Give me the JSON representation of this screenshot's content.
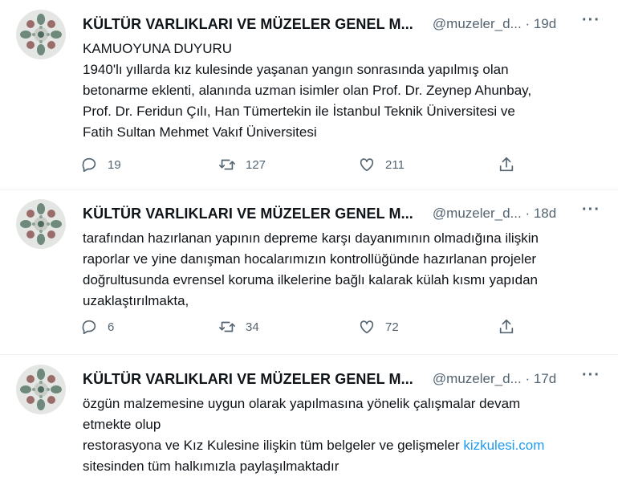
{
  "tweets": [
    {
      "name": "KÜLTÜR VARLIKLARI VE MÜZELER GENEL M...",
      "handle": "@muzeler_d...",
      "time": "· 19d",
      "more": "···",
      "lines": [
        "KAMUOYUNA DUYURU",
        "1940'lı yıllarda kız kulesinde yaşanan yangın sonrasında yapılmış olan",
        "betonarme eklenti, alanında uzman isimler olan Prof. Dr. Zeynep Ahunbay,",
        "Prof. Dr. Feridun Çılı, Han Tümertekin ile İstanbul Teknik Üniversitesi ve",
        "Fatih Sultan Mehmet Vakıf Üniversitesi"
      ],
      "replies": "19",
      "retweets": "127",
      "likes": "211"
    },
    {
      "name": "KÜLTÜR VARLIKLARI VE MÜZELER GENEL M...",
      "handle": "@muzeler_d...",
      "time": "· 18d",
      "more": "···",
      "lines": [
        "tarafından hazırlanan yapının  depreme karşı dayanımının olmadığına ilişkin",
        "raporlar ve yine danışman hocalarımızın kontrollüğünde hazırlanan projeler",
        "doğrultusunda evrensel koruma ilkelerine bağlı kalarak külah kısmı yapıdan",
        "uzaklaştırılmakta,"
      ],
      "replies": "6",
      "retweets": "34",
      "likes": "72"
    },
    {
      "name": "KÜLTÜR VARLIKLARI VE MÜZELER GENEL M...",
      "handle": "@muzeler_d...",
      "time": "· 17d",
      "more": "···",
      "lines": [
        "özgün malzemesine uygun olarak yapılmasına yönelik çalışmalar devam",
        "etmekte olup",
        "restorasyona ve Kız Kulesine ilişkin tüm belgeler ve gelişmeler ",
        "sitesinden tüm halkımızla paylaşılmaktadır"
      ],
      "link": "kizkulesi.com"
    }
  ],
  "colors": {
    "text": "#0f1419",
    "muted": "#536471",
    "link": "#1d9bf0",
    "divider": "#eff3f4"
  },
  "icons": [
    "reply-icon",
    "retweet-icon",
    "like-icon",
    "share-icon",
    "more-icon",
    "avatar-logo"
  ]
}
